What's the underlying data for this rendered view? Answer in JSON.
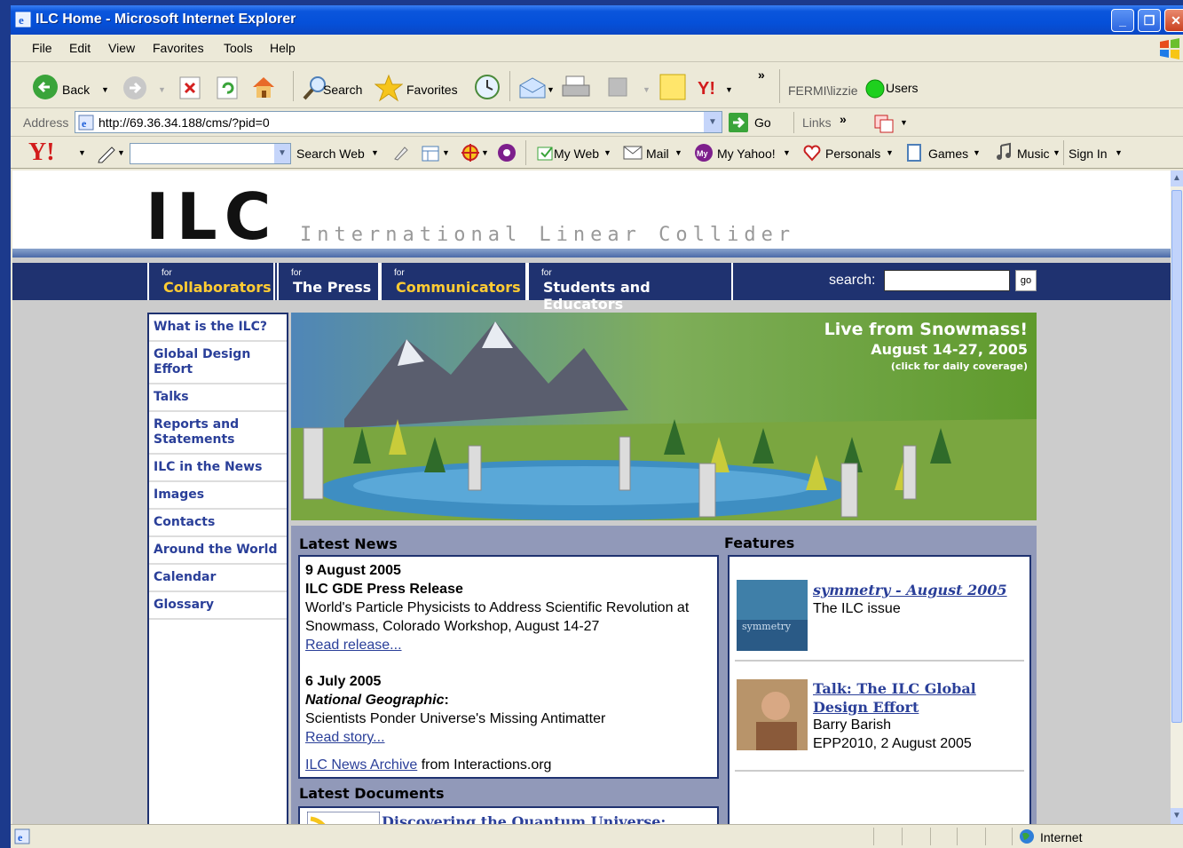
{
  "window": {
    "title": "ILC Home - Microsoft Internet Explorer"
  },
  "menu": [
    "File",
    "Edit",
    "View",
    "Favorites",
    "Tools",
    "Help"
  ],
  "toolbar": {
    "back": "Back",
    "search": "Search",
    "favorites": "Favorites",
    "more": "»",
    "user": "FERMI\\lizzie",
    "users": "Users"
  },
  "address": {
    "label": "Address",
    "url": "http://69.36.34.188/cms/?pid=0",
    "go": "Go",
    "links": "Links",
    "more": "»"
  },
  "yahoo": {
    "logo": "Y!",
    "search_web": "Search Web",
    "my_web": "My Web",
    "mail": "Mail",
    "my_yahoo": "My Yahoo!",
    "personals": "Personals",
    "games": "Games",
    "music": "Music",
    "sign_in": "Sign In"
  },
  "site": {
    "logo": "ILC",
    "tagline": "International Linear Collider",
    "nav": [
      {
        "for": "for",
        "label": "Collaborators",
        "color": "#ffcc33"
      },
      {
        "for": "for",
        "label": "The Press",
        "color": "#ffffff"
      },
      {
        "for": "for",
        "label": "Communicators",
        "color": "#ffcc33"
      },
      {
        "for": "for",
        "label": "Students and Educators",
        "color": "#ffffff"
      }
    ],
    "search_label": "search:",
    "search_go": "go",
    "sidebar": [
      "What is the ILC?",
      "Global Design Effort",
      "Talks",
      "Reports and Statements",
      "ILC in the News",
      "Images",
      "Contacts",
      "Around the World",
      "Calendar",
      "Glossary"
    ],
    "hero": {
      "line1": "Live from Snowmass!",
      "line2": "August 14-27, 2005",
      "line3": "(click for daily coverage)"
    },
    "latest_news_title": "Latest News",
    "news": [
      {
        "date": "9 August 2005",
        "headline": "ILC GDE Press Release",
        "body": "World's Particle Physicists to Address Scientific Revolution at Snowmass, Colorado Workshop, August 14-27",
        "link": "Read release..."
      },
      {
        "date": "6 July 2005",
        "headline": "National Geographic",
        "headline_suffix": ":",
        "body": "Scientists Ponder Universe's Missing Antimatter",
        "link": "Read story..."
      }
    ],
    "news_archive_link": "ILC News Archive",
    "news_archive_suffix": " from Interactions.org",
    "features_title": "Features",
    "features": [
      {
        "title": "symmetry - August 2005",
        "line1": "The ILC issue",
        "line2": ""
      },
      {
        "title": "Talk: The ILC Global Design Effort",
        "line1": "Barry Barish",
        "line2": "EPP2010, 2 August 2005"
      }
    ],
    "latest_docs_title": "Latest Documents",
    "doc_title": "Discovering the Quantum Universe:"
  },
  "status": {
    "zone": "Internet"
  }
}
